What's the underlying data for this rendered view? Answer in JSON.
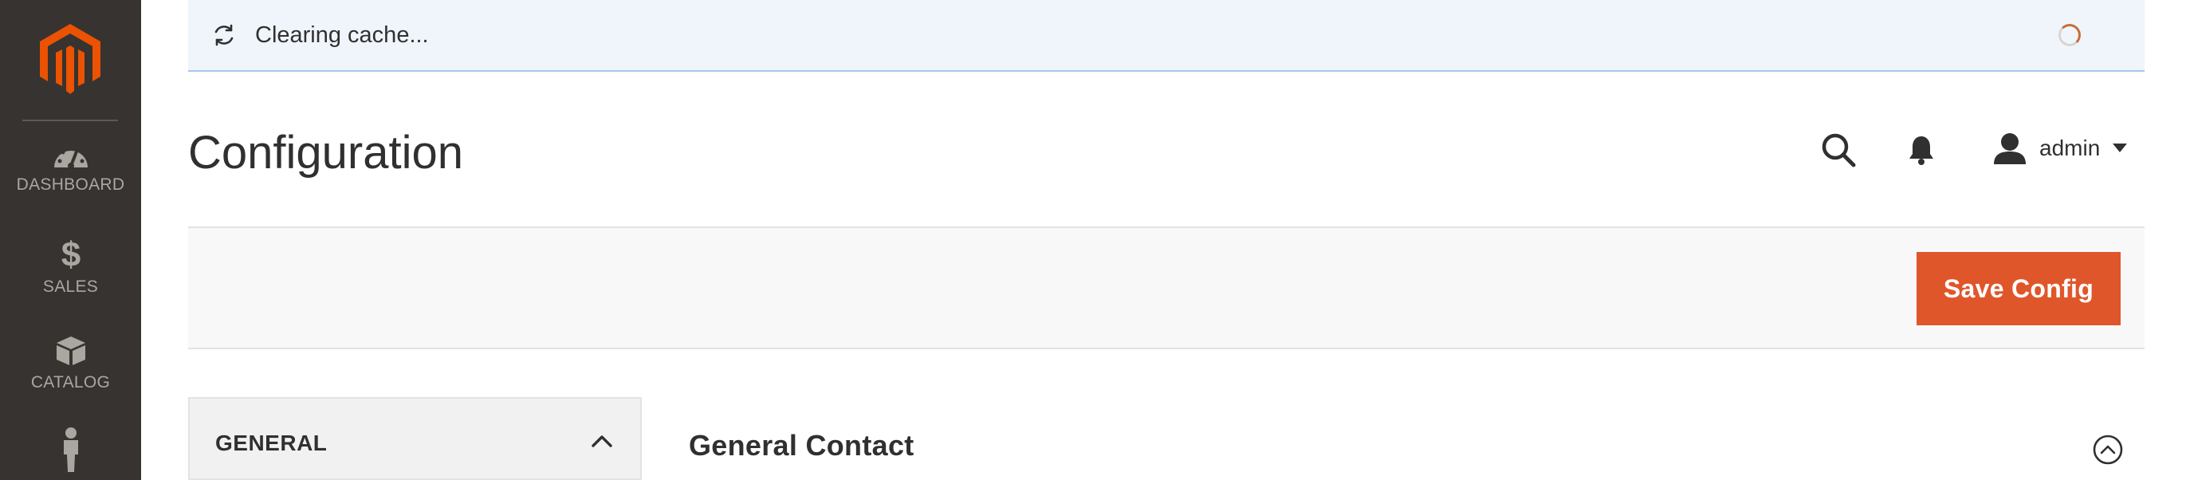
{
  "sidebar": {
    "logo_icon": "magento-logo-icon",
    "items": [
      {
        "label": "DASHBOARD",
        "icon": "dashboard-gauge-icon"
      },
      {
        "label": "SALES",
        "icon": "dollar-icon"
      },
      {
        "label": "CATALOG",
        "icon": "box-icon"
      },
      {
        "label": "",
        "icon": "customer-person-icon"
      }
    ]
  },
  "message": {
    "text": "Clearing cache...",
    "icon": "refresh-icon",
    "loading": true
  },
  "header": {
    "title": "Configuration",
    "user_name": "admin"
  },
  "toolbar": {
    "save_label": "Save Config"
  },
  "tabs": {
    "group_title": "GENERAL",
    "expanded": true
  },
  "section": {
    "title": "General Contact",
    "expanded": true
  },
  "colors": {
    "sidebar_bg": "#373330",
    "accent": "#e0562b",
    "message_bg": "#f0f5fc",
    "message_border": "#a8c6ee",
    "logo": "#eb5202"
  }
}
